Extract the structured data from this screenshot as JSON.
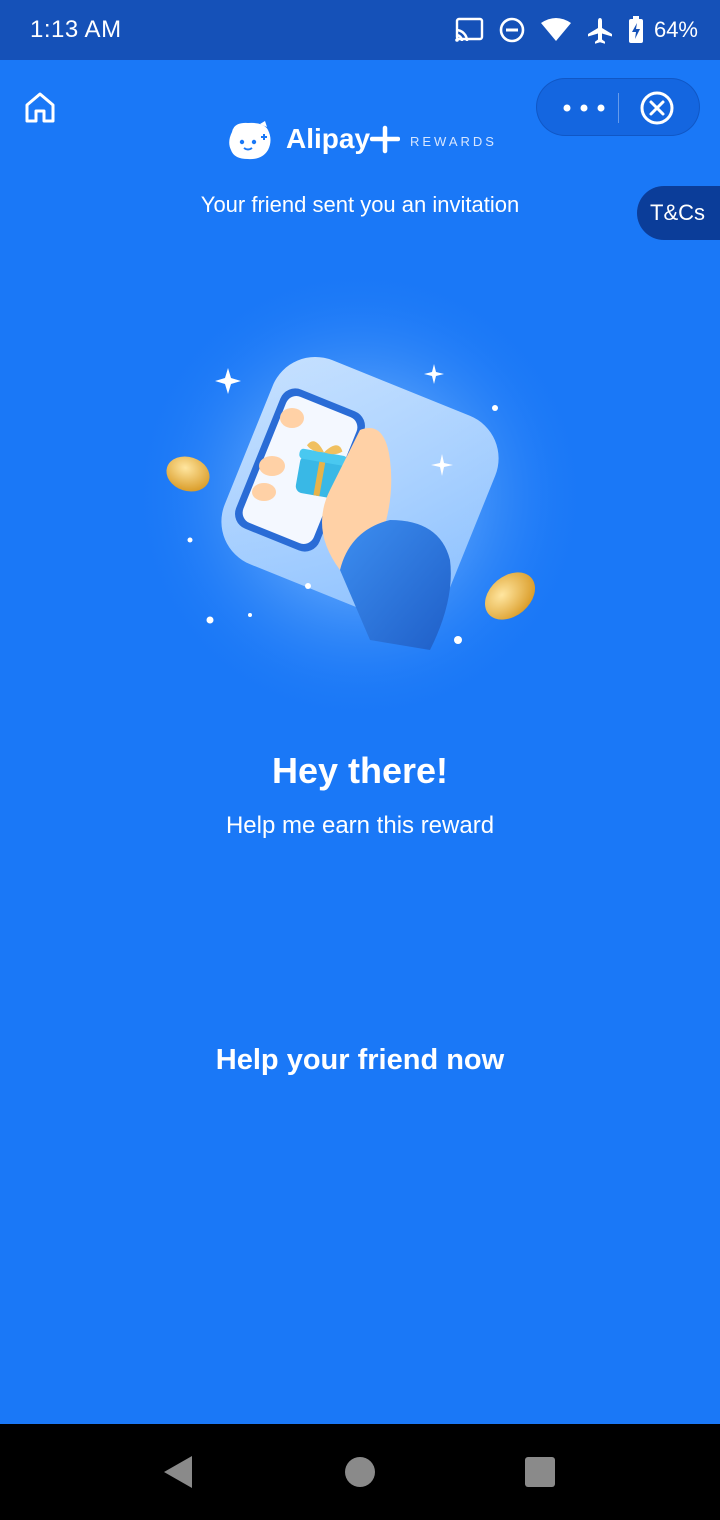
{
  "status_bar": {
    "time": "1:13 AM",
    "battery_percent": "64%",
    "icons": [
      "cast-icon",
      "do-not-disturb-icon",
      "wifi-icon",
      "airplane-mode-icon",
      "battery-charging-icon"
    ]
  },
  "header": {
    "brand_name": "Alipay",
    "brand_tagline": "REWARDS",
    "icons": [
      "home-icon",
      "more-options-icon",
      "close-circle-icon"
    ]
  },
  "invite_text": "Your friend sent you an invitation",
  "tnc_label": "T&Cs",
  "hero_illustration": "hand holding phone with gift",
  "headline": "Hey there!",
  "subline": "Help me earn this reward",
  "cta_label": "Help your friend now",
  "colors": {
    "background": "#1a78f7",
    "status_bar": "#1551b8",
    "tnc_button": "#0b3d99",
    "capsule": "#1466e0",
    "text": "#ffffff"
  }
}
